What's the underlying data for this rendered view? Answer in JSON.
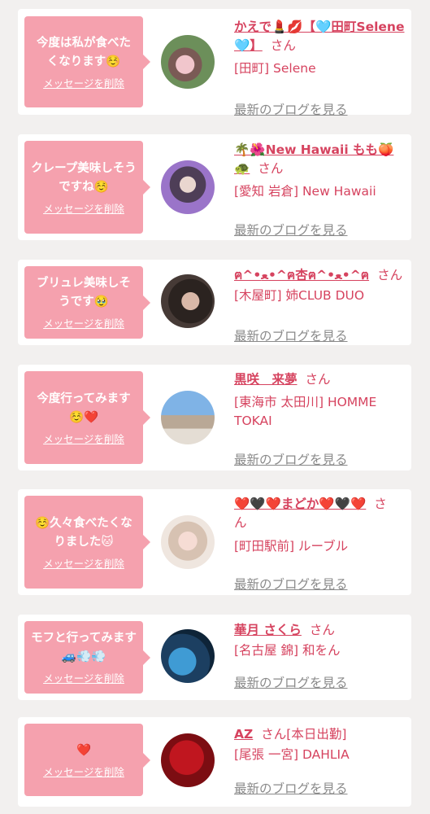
{
  "colors": {
    "accent": "#d6435f",
    "bubble": "#f5a1ae",
    "link_gray": "#8a8a8a",
    "background": "#f2f0ef"
  },
  "delete_label": "メッセージを削除",
  "blog_label": "最新のブログを見る",
  "san_label": "さん",
  "items": [
    {
      "message": "今度は私が食べたくなります☺️",
      "name": "かえで💄💋【🩵田町Selene🩵】",
      "shop": "[田町] Selene"
    },
    {
      "message": "クレープ美味しそうですね☺️",
      "name": "🌴🌺New Hawaii もも🍑🐢",
      "shop": "[愛知 岩倉] New Hawaii"
    },
    {
      "message": "ブリュレ美味しそうです🥹",
      "name": "ฅ^•ﻌ•^ฅ杏ฅ^•ﻌ•^ฅ",
      "shop": "[木屋町] 姉CLUB DUO"
    },
    {
      "message": "今度行ってみます☺️❤️",
      "name": "黒咲　来夢",
      "shop": "[東海市 太田川] HOMME TOKAI"
    },
    {
      "message": "☺️久々食べたくなりました🐱",
      "name": "❤️🖤❤️まどか❤️🖤❤️",
      "shop": "[町田駅前] ルーブル"
    },
    {
      "message": "モフと行ってみます🚙💨💨",
      "name": "華月 さくら",
      "shop": "[名古屋 錦] 和をん"
    },
    {
      "message": "❤️",
      "name": "AZ",
      "status": "[本日出勤]",
      "shop": "[尾張 一宮] DAHLIA"
    }
  ]
}
